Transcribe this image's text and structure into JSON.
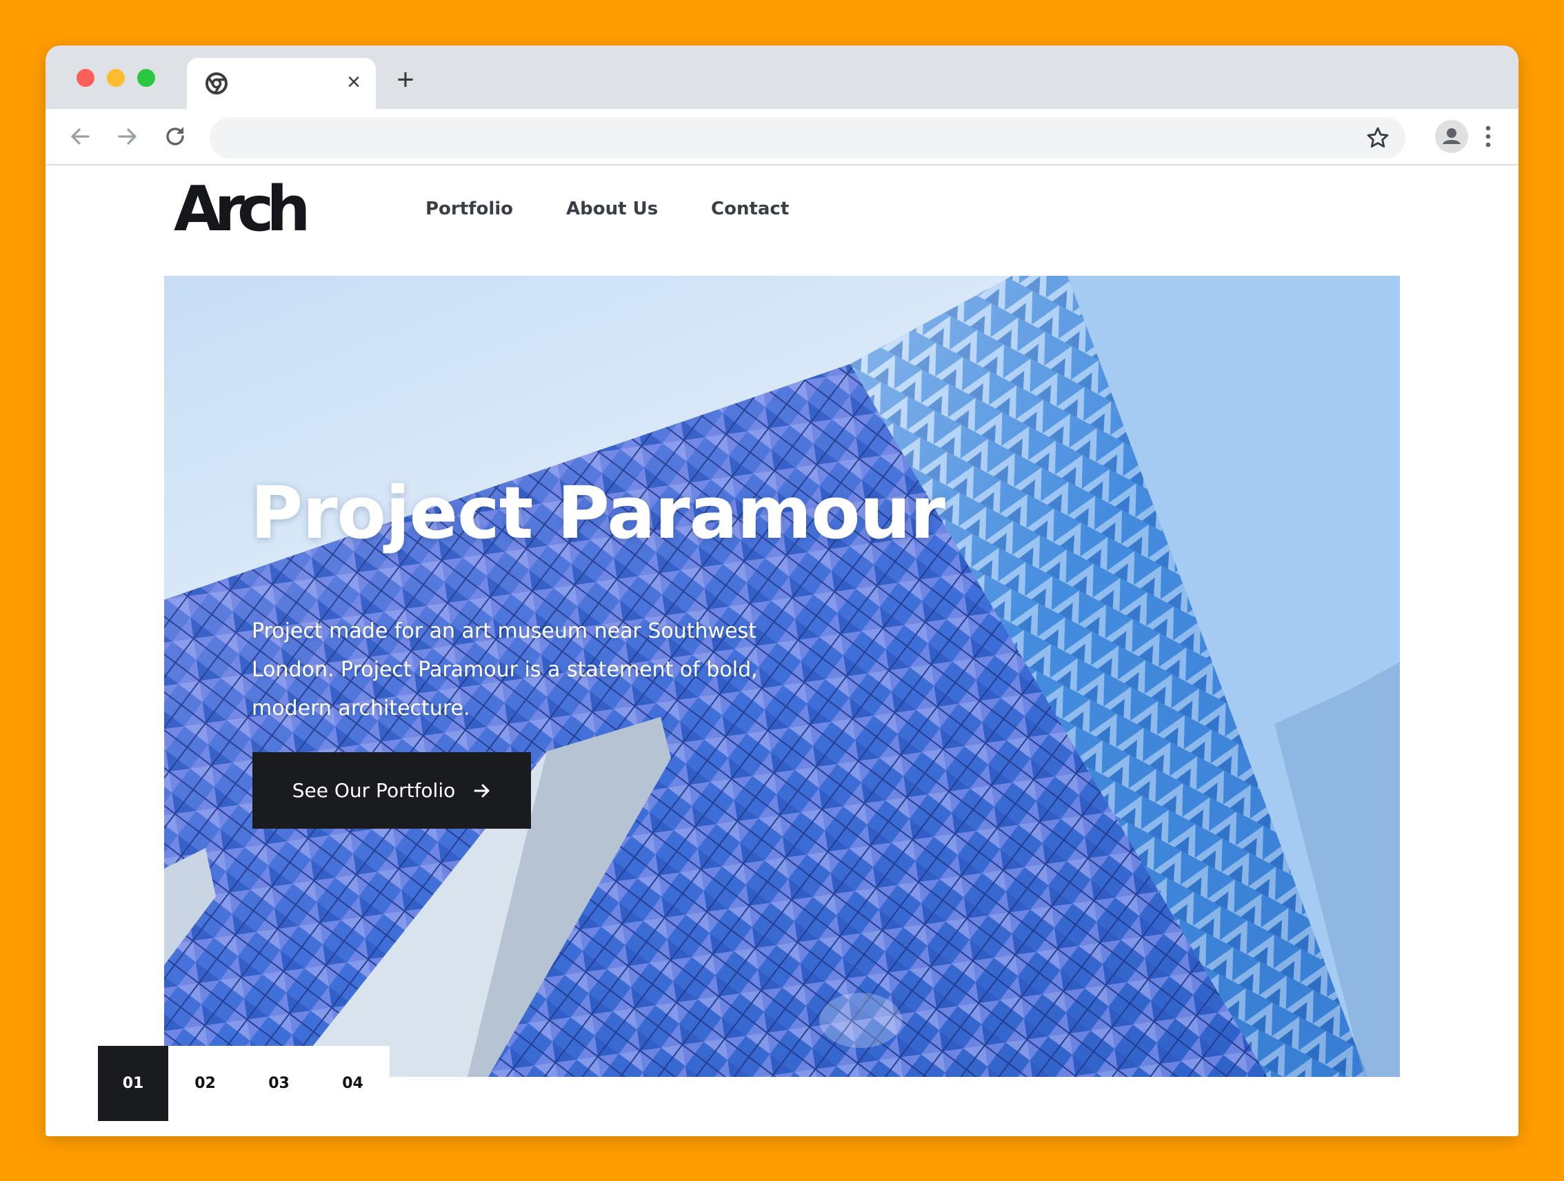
{
  "browser": {
    "tab": {
      "favicon": "chrome-icon",
      "close_icon": "close-icon",
      "close_glyph": "×"
    },
    "new_tab_glyph": "+",
    "toolbar": {
      "back_icon": "arrow-left-icon",
      "forward_icon": "arrow-right-icon",
      "reload_icon": "reload-icon",
      "address": "",
      "bookmark_icon": "star-icon",
      "profile_icon": "user-avatar-icon",
      "menu_icon": "more-vert-icon"
    },
    "traffic_lights": {
      "close": "#FE5F57",
      "minimize": "#FEBC2E",
      "maximize": "#28C840"
    }
  },
  "site": {
    "logo": "Arch",
    "nav": [
      "Portfolio",
      "About Us",
      "Contact"
    ],
    "hero": {
      "title": "Project Paramour",
      "description": "Project made for an art museum near Southwest London. Project Paramour is a statement of bold, modern architecture.",
      "button_label": "See Our Portfolio",
      "button_icon": "arrow-right-icon"
    },
    "pager": [
      "01",
      "02",
      "03",
      "04"
    ],
    "pager_active": "01"
  },
  "colors": {
    "background": "#FF9C00",
    "dark": "#1A1B1F",
    "nav_text": "#3A3F47",
    "sky": "#6FB0EA"
  }
}
